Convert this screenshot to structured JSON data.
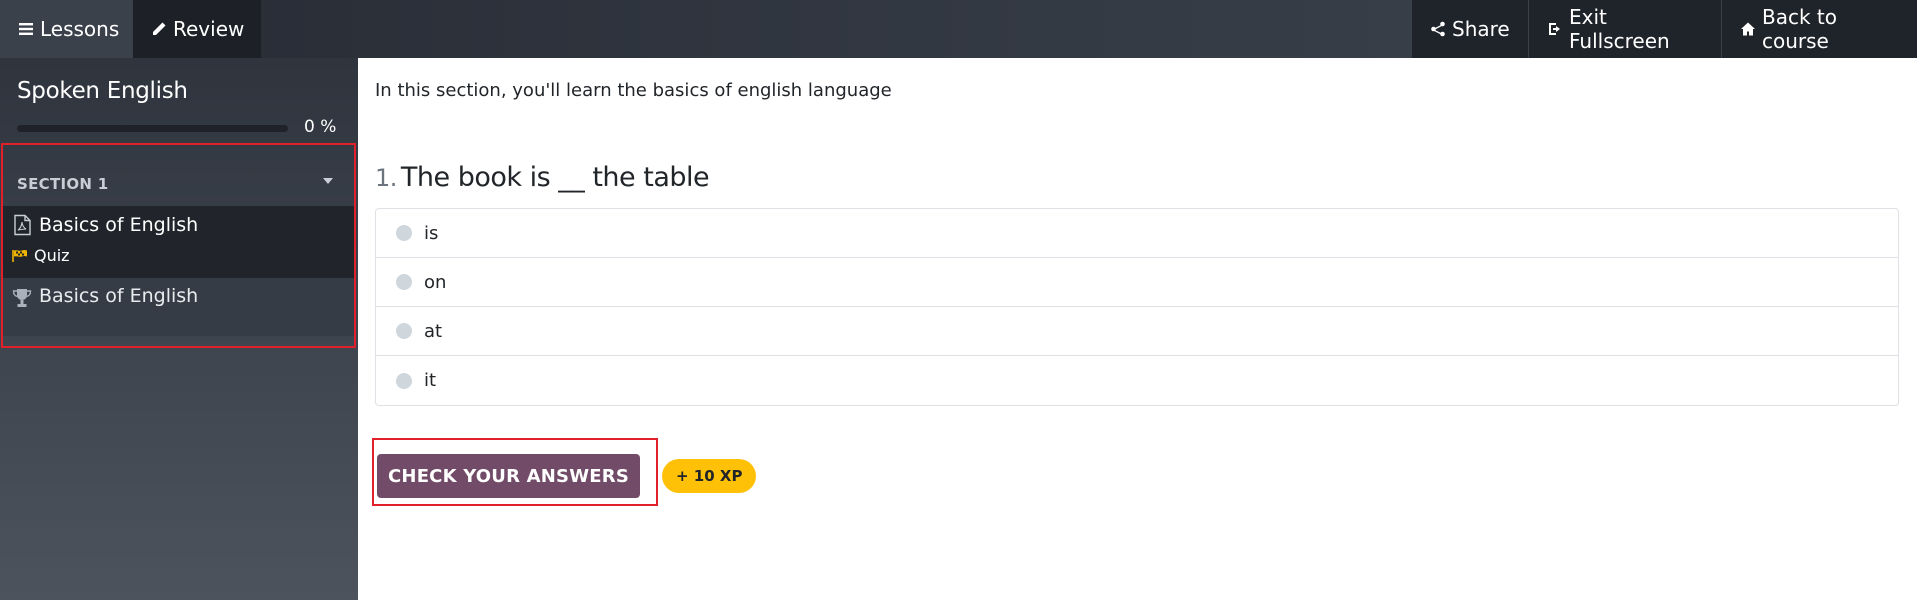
{
  "topbar": {
    "left": [
      {
        "label": "Lessons",
        "icon": "bars-icon"
      },
      {
        "label": "Review",
        "icon": "pencil-icon"
      }
    ],
    "right": [
      {
        "label": "Share",
        "icon": "share-icon"
      },
      {
        "label": "Exit Fullscreen",
        "icon": "exit-icon"
      },
      {
        "label": "Back to course",
        "icon": "home-icon"
      }
    ]
  },
  "sidebar": {
    "course_title": "Spoken English",
    "progress_fraction": 0,
    "progress_text": "0 %",
    "section": {
      "title": "SECTION 1",
      "items": [
        {
          "title": "Basics of English",
          "icon": "file-pdf-icon",
          "sub_label": "Quiz",
          "sub_icon": "flag-icon"
        },
        {
          "title": "Basics of English",
          "icon": "trophy-icon"
        }
      ]
    }
  },
  "main": {
    "intro": "In this section, you'll learn the basics of english language",
    "question": {
      "number": "1.",
      "text": "The book is __ the table",
      "answers": [
        "is",
        "on",
        "at",
        "it"
      ]
    },
    "check_button": "CHECK YOUR ANSWERS",
    "xp_badge": "+ 10 XP"
  },
  "colors": {
    "accent": "#714b67",
    "badge": "#ffc107",
    "highlight": "#e0202a"
  }
}
